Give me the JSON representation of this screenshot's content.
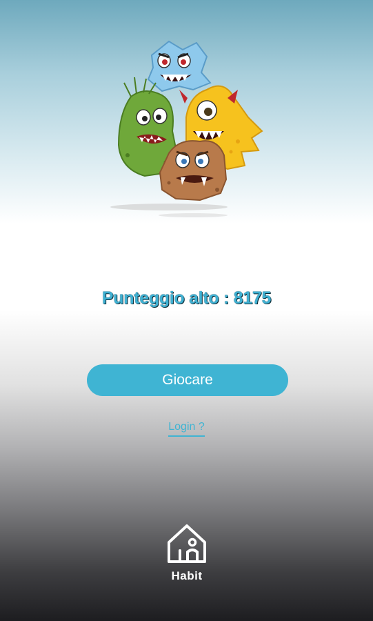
{
  "illustration": {
    "name": "monsters-illustration"
  },
  "high_score": {
    "label": "Punteggio alto : 8175",
    "value": 8175
  },
  "play_button": {
    "label": "Giocare"
  },
  "login_link": {
    "label": "Login ?"
  },
  "brand": {
    "name": "Habit"
  },
  "colors": {
    "accent": "#3fb4d3",
    "score_text": "#3fb1d3",
    "logo": "#ffffff"
  }
}
